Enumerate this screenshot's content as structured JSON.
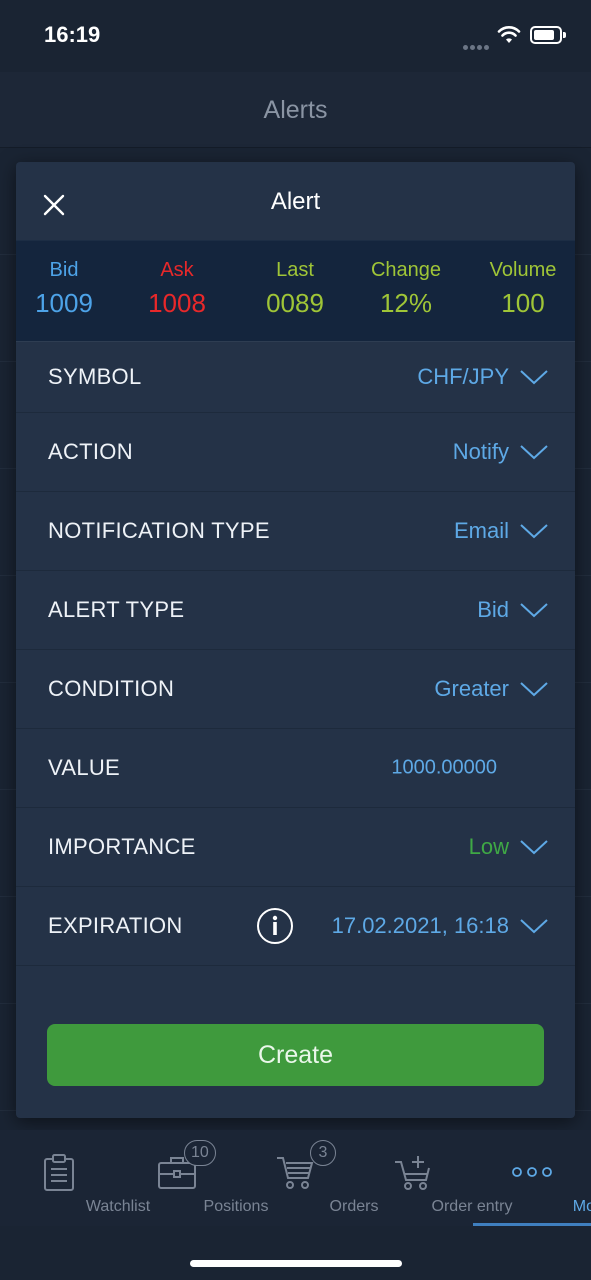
{
  "status_bar": {
    "time": "16:19"
  },
  "page": {
    "title": "Alerts"
  },
  "modal": {
    "title": "Alert",
    "quote": [
      {
        "label": "Bid",
        "value": "1009",
        "color": "#4da3e8"
      },
      {
        "label": "Ask",
        "value": "1008",
        "color": "#e8282a"
      },
      {
        "label": "Last",
        "value": "0089",
        "color": "#9fc537"
      },
      {
        "label": "Change",
        "value": "12%",
        "color": "#9fc537"
      },
      {
        "label": "Volume",
        "value": "100",
        "color": "#9fc537"
      }
    ],
    "rows": [
      {
        "label": "SYMBOL",
        "value": "CHF/JPY"
      },
      {
        "label": "ACTION",
        "value": "Notify"
      },
      {
        "label": "NOTIFICATION TYPE",
        "value": "Email"
      },
      {
        "label": "ALERT TYPE",
        "value": "Bid"
      },
      {
        "label": "CONDITION",
        "value": "Greater"
      },
      {
        "label": "VALUE",
        "value": "1000.00000"
      },
      {
        "label": "IMPORTANCE",
        "value": "Low"
      },
      {
        "label": "EXPIRATION",
        "value": "17.02.2021, 16:18"
      }
    ],
    "create_label": "Create"
  },
  "tabbar": {
    "tabs": [
      {
        "label": "Watchlist",
        "icon": "clipboard-icon"
      },
      {
        "label": "Positions",
        "icon": "briefcase-icon",
        "badge": "10"
      },
      {
        "label": "Orders",
        "icon": "cart-icon",
        "badge": "3"
      },
      {
        "label": "Order entry",
        "icon": "cart-plus-icon"
      },
      {
        "label": "More",
        "icon": "more-dots-icon"
      }
    ]
  },
  "colors": {
    "accent": "#5ea9e6",
    "green": "#3f9a3d",
    "modal_bg": "#243247",
    "quote_bg": "#14253d"
  }
}
